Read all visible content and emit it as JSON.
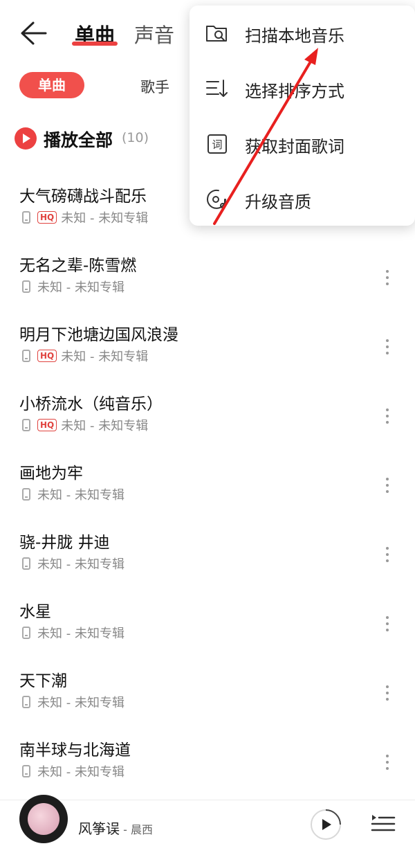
{
  "header": {
    "tabs": [
      {
        "label": "单曲",
        "active": true
      },
      {
        "label": "声音",
        "active": false
      }
    ]
  },
  "subtabs": [
    {
      "label": "单曲",
      "active": true
    },
    {
      "label": "歌手",
      "active": false
    }
  ],
  "play_all": {
    "label": "播放全部",
    "count": "(10)"
  },
  "songs": [
    {
      "title": "大气磅礴战斗配乐",
      "hq": true,
      "meta": "未知 - 未知专辑"
    },
    {
      "title": "无名之辈-陈雪燃",
      "hq": false,
      "meta": "未知 - 未知专辑"
    },
    {
      "title": "明月下池塘边国风浪漫",
      "hq": true,
      "meta": "未知 - 未知专辑"
    },
    {
      "title": "小桥流水（纯音乐）",
      "hq": true,
      "meta": "未知 - 未知专辑"
    },
    {
      "title": "画地为牢",
      "hq": false,
      "meta": "未知 - 未知专辑"
    },
    {
      "title": "骁-井胧 井迪",
      "hq": false,
      "meta": "未知 - 未知专辑"
    },
    {
      "title": "水星",
      "hq": false,
      "meta": "未知 - 未知专辑"
    },
    {
      "title": "天下潮",
      "hq": false,
      "meta": "未知 - 未知专辑"
    },
    {
      "title": "南半球与北海道",
      "hq": false,
      "meta": "未知 - 未知专辑"
    }
  ],
  "hq_label": "HQ",
  "menu": {
    "items": [
      {
        "label": "扫描本地音乐",
        "icon": "scan-folder-icon"
      },
      {
        "label": "选择排序方式",
        "icon": "sort-icon"
      },
      {
        "label": "获取封面歌词",
        "icon": "lyrics-icon"
      },
      {
        "label": "升级音质",
        "icon": "quality-disc-icon"
      }
    ]
  },
  "now_playing": {
    "title": "风筝误",
    "separator": " - ",
    "artist": "晨西"
  },
  "colors": {
    "accent": "#ec4141",
    "annotation_arrow": "#e8201f"
  }
}
